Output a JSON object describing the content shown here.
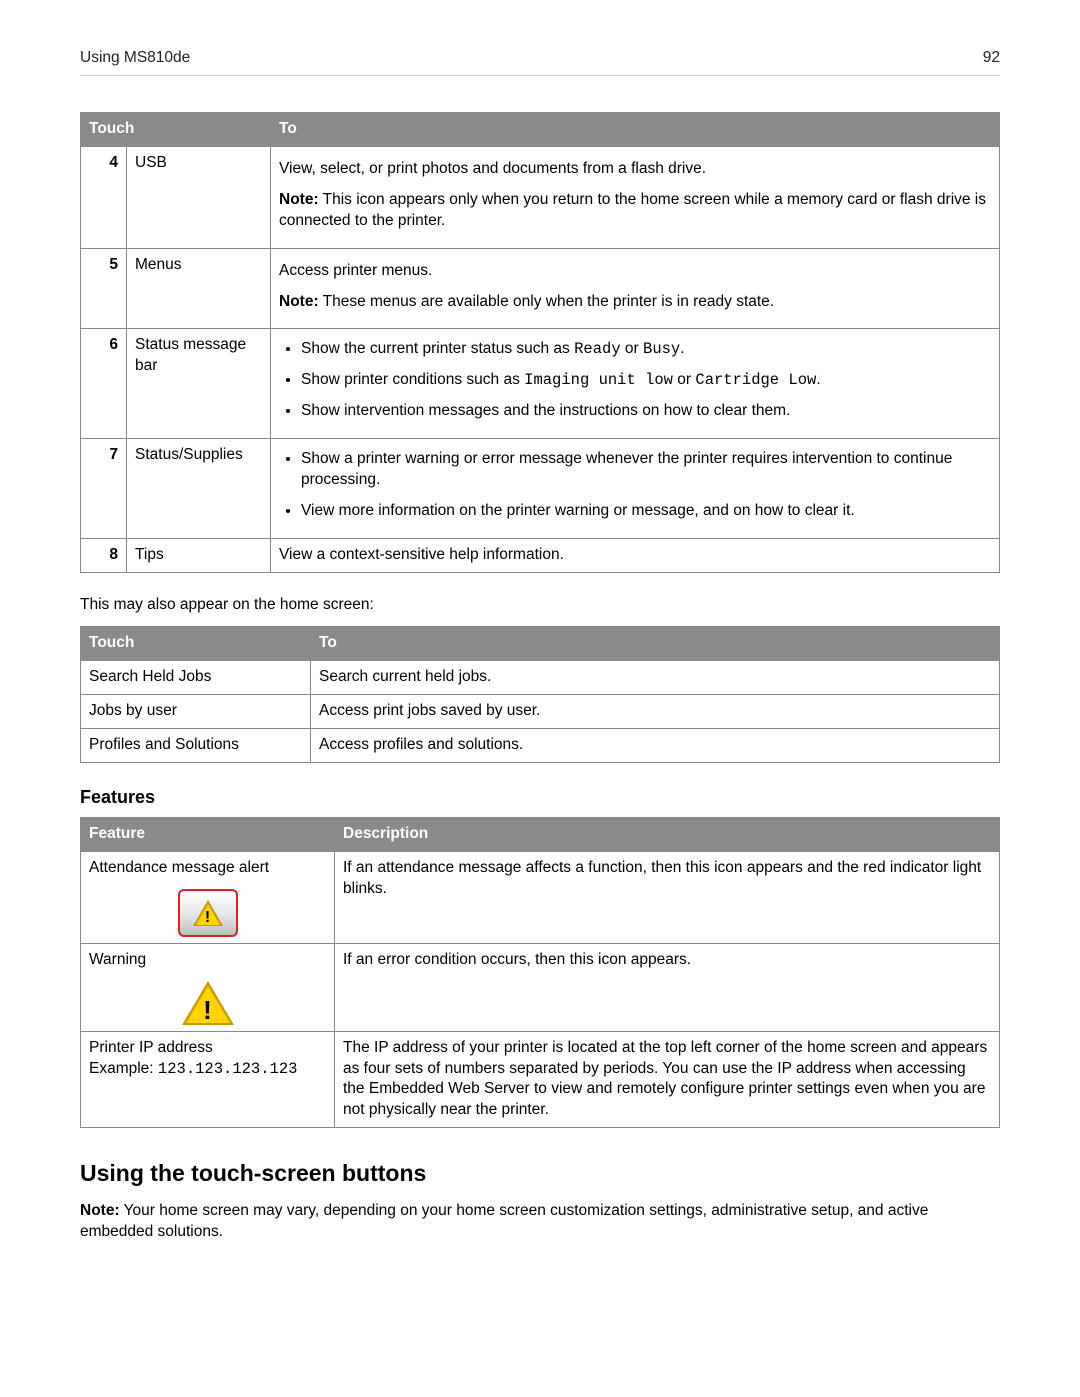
{
  "header": {
    "title": "Using MS810de",
    "page_number": "92"
  },
  "table1": {
    "th_touch": "Touch",
    "th_to": "To",
    "rows": [
      {
        "num": "4",
        "touch": "USB",
        "desc1": "View, select, or print photos and documents from a flash drive.",
        "note_label": "Note:",
        "note_text": " This icon appears only when you return to the home screen while a memory card or flash drive is connected to the printer."
      },
      {
        "num": "5",
        "touch": "Menus",
        "desc1": "Access printer menus.",
        "note_label": "Note:",
        "note_text": " These menus are available only when the printer is in ready state."
      },
      {
        "num": "6",
        "touch": "Status message bar",
        "bullets": [
          {
            "pre": "Show the current printer status such as ",
            "code1": "Ready",
            "mid": " or ",
            "code2": "Busy",
            "post": "."
          },
          {
            "pre": "Show printer conditions such as ",
            "code1": "Imaging unit low",
            "mid": " or ",
            "code2": "Cartridge Low",
            "post": "."
          },
          {
            "pre": "Show intervention messages and the instructions on how to clear them.",
            "code1": "",
            "mid": "",
            "code2": "",
            "post": ""
          }
        ]
      },
      {
        "num": "7",
        "touch": "Status/Supplies",
        "bullets": [
          {
            "pre": "Show a printer warning or error message whenever the printer requires intervention to continue processing.",
            "code1": "",
            "mid": "",
            "code2": "",
            "post": ""
          },
          {
            "pre": "View more information on the printer warning or message, and on how to clear it.",
            "code1": "",
            "mid": "",
            "code2": "",
            "post": ""
          }
        ]
      },
      {
        "num": "8",
        "touch": "Tips",
        "desc1": "View a context-sensitive help information."
      }
    ]
  },
  "intro_text": "This may also appear on the home screen:",
  "table2": {
    "th_touch": "Touch",
    "th_to": "To",
    "rows": [
      {
        "touch": "Search Held Jobs",
        "to": "Search current held jobs."
      },
      {
        "touch": "Jobs by user",
        "to": "Access print jobs saved by user."
      },
      {
        "touch": "Profiles and Solutions",
        "to": "Access profiles and solutions."
      }
    ]
  },
  "features_heading": "Features",
  "table3": {
    "th_feature": "Feature",
    "th_desc": "Description",
    "rows": [
      {
        "feature": "Attendance message alert",
        "desc": "If an attendance message affects a function, then this icon appears and the red indicator light blinks."
      },
      {
        "feature": "Warning",
        "desc": "If an error condition occurs, then this icon appears."
      },
      {
        "feature": "Printer IP address",
        "example_label": "Example: ",
        "example_code": "123.123.123.123",
        "desc": "The IP address of your printer is located at the top left corner of the home screen and appears as four sets of numbers separated by periods. You can use the IP address when accessing the Embedded Web Server to view and remotely configure printer settings even when you are not physically near the printer."
      }
    ]
  },
  "section_heading": "Using the touch-screen buttons",
  "section_note_label": "Note:",
  "section_note_text": " Your home screen may vary, depending on your home screen customization settings, administrative setup, and active embedded solutions."
}
